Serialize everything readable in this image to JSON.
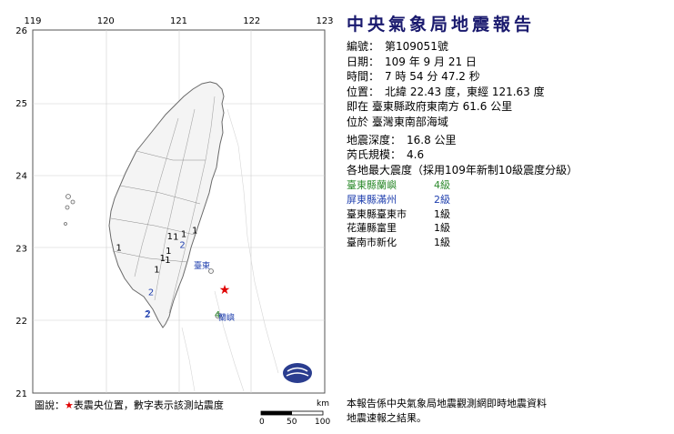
{
  "report": {
    "title": "中央氣象局地震報告",
    "number_label": "編號：",
    "number_value": "第109051號",
    "date_label": "日期：",
    "date_value": "109 年 9 月 21 日",
    "time_label": "時間：",
    "time_value": "7 時 54 分 47.2 秒",
    "position_label": "位置：",
    "position_value": "北緯 22.43 度，東經 121.63 度",
    "located_text": "即在 臺東縣政府東南方 61.6 公里",
    "region_text": "位於 臺灣東南部海域",
    "depth_label": "地震深度：",
    "depth_value": "16.8 公里",
    "magnitude_label": "芮氏規模：",
    "magnitude_value": "4.6",
    "intensity_header": "各地最大震度（採用109年新制10級震度分級）",
    "intensities": [
      {
        "area": "臺東縣蘭嶼",
        "level": "4級",
        "color": "#2e8b2e"
      },
      {
        "area": "屏東縣滿州",
        "level": "2級",
        "color": "#1f3fae"
      },
      {
        "area": "臺東縣臺東市",
        "level": "1級",
        "color": "#000000"
      },
      {
        "area": "花蓮縣富里",
        "level": "1級",
        "color": "#000000"
      },
      {
        "area": "臺南市新化",
        "level": "1級",
        "color": "#000000"
      }
    ],
    "footer_line1": "本報告係中央氣象局地震觀測網即時地震資料",
    "footer_line2": "地震速報之結果。"
  },
  "map": {
    "lon_ticks": [
      "119",
      "120",
      "121",
      "122",
      "123"
    ],
    "lat_ticks": [
      "26",
      "25",
      "24",
      "23",
      "22",
      "21"
    ],
    "epicenter": {
      "lon": 121.63,
      "lat": 22.43
    },
    "stations": [
      {
        "label": "1",
        "lon": 120.18,
        "lat": 22.96
      },
      {
        "label": "1",
        "lon": 120.88,
        "lat": 23.12
      },
      {
        "label": "1",
        "lon": 120.96,
        "lat": 23.11
      },
      {
        "label": "1",
        "lon": 121.07,
        "lat": 23.15
      },
      {
        "label": "1",
        "lon": 121.22,
        "lat": 23.2
      },
      {
        "label": "1",
        "lon": 120.86,
        "lat": 22.92
      },
      {
        "label": "1",
        "lon": 120.78,
        "lat": 22.82
      },
      {
        "label": "1",
        "lon": 120.7,
        "lat": 22.66
      },
      {
        "label": "1",
        "lon": 120.85,
        "lat": 22.79
      },
      {
        "label": "2",
        "lon": 121.05,
        "lat": 23.0
      },
      {
        "label": "2",
        "lon": 120.62,
        "lat": 22.35
      },
      {
        "label": "2",
        "lon": 120.58,
        "lat": 22.05
      },
      {
        "label": "2",
        "lon": 120.57,
        "lat": 22.04
      },
      {
        "label": "4",
        "lon": 121.53,
        "lat": 22.04
      }
    ],
    "place_labels": {
      "taitung": "臺東",
      "lanyu": "蘭嶼"
    },
    "scale": {
      "unit": "km",
      "ticks": [
        "0",
        "50",
        "100"
      ]
    },
    "colors": {
      "land": "#f2f2f2",
      "sea": "#ffffff",
      "border": "#7a7a7a",
      "grid": "#c8c8c8",
      "epicenter": "#e00000"
    }
  },
  "legend": {
    "prefix": "圖說：",
    "star": "★",
    "text": "表震央位置，數字表示該測站震度"
  }
}
